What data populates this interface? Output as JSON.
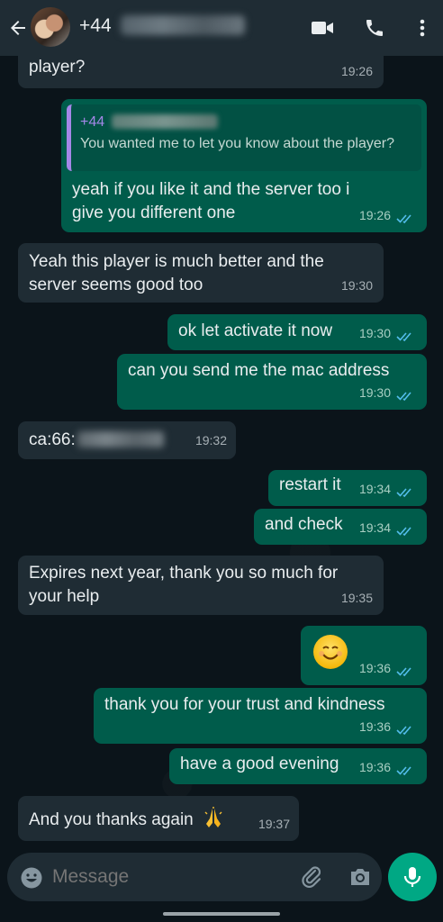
{
  "header": {
    "contact_prefix": "+44",
    "icons": [
      "back-arrow-icon",
      "video-call-icon",
      "phone-call-icon",
      "more-options-icon"
    ]
  },
  "messages": [
    {
      "dir": "in",
      "text": "player?",
      "time": "19:26"
    },
    {
      "dir": "out",
      "quote_name": "+44",
      "quote_text": "You wanted me to let you know about the player?",
      "text": "yeah if you like it and the server too i give you different one",
      "time": "19:26",
      "read": true
    },
    {
      "dir": "in",
      "text": "Yeah this player is much better and the server seems good too",
      "time": "19:30"
    },
    {
      "dir": "out",
      "text": "ok let activate it now",
      "time": "19:30",
      "read": true
    },
    {
      "dir": "out",
      "text": "can you send me the mac address",
      "time": "19:30",
      "read": true
    },
    {
      "dir": "in",
      "text": "ca:66:",
      "time": "19:32"
    },
    {
      "dir": "out",
      "text": "restart it",
      "time": "19:34",
      "read": true
    },
    {
      "dir": "out",
      "text": "and check",
      "time": "19:34",
      "read": true
    },
    {
      "dir": "in",
      "text": "Expires next year, thank you so much for your help",
      "time": "19:35"
    },
    {
      "dir": "out",
      "text": "😊",
      "time": "19:36",
      "read": true
    },
    {
      "dir": "out",
      "text": "thank you for your trust and kindness",
      "time": "19:36",
      "read": true
    },
    {
      "dir": "out",
      "text": "have a good evening",
      "time": "19:36",
      "read": true
    },
    {
      "dir": "in",
      "text": "And you thanks again",
      "time": "19:37"
    }
  ],
  "composer": {
    "placeholder": "Message",
    "icons": [
      "emoji-icon",
      "attach-icon",
      "camera-icon",
      "mic-icon"
    ]
  },
  "colors": {
    "background": "#0b141a",
    "header": "#1f2c34",
    "incoming": "#1f2c34",
    "outgoing": "#005c4b",
    "accent": "#00a884",
    "read_ticks": "#53bdeb"
  }
}
